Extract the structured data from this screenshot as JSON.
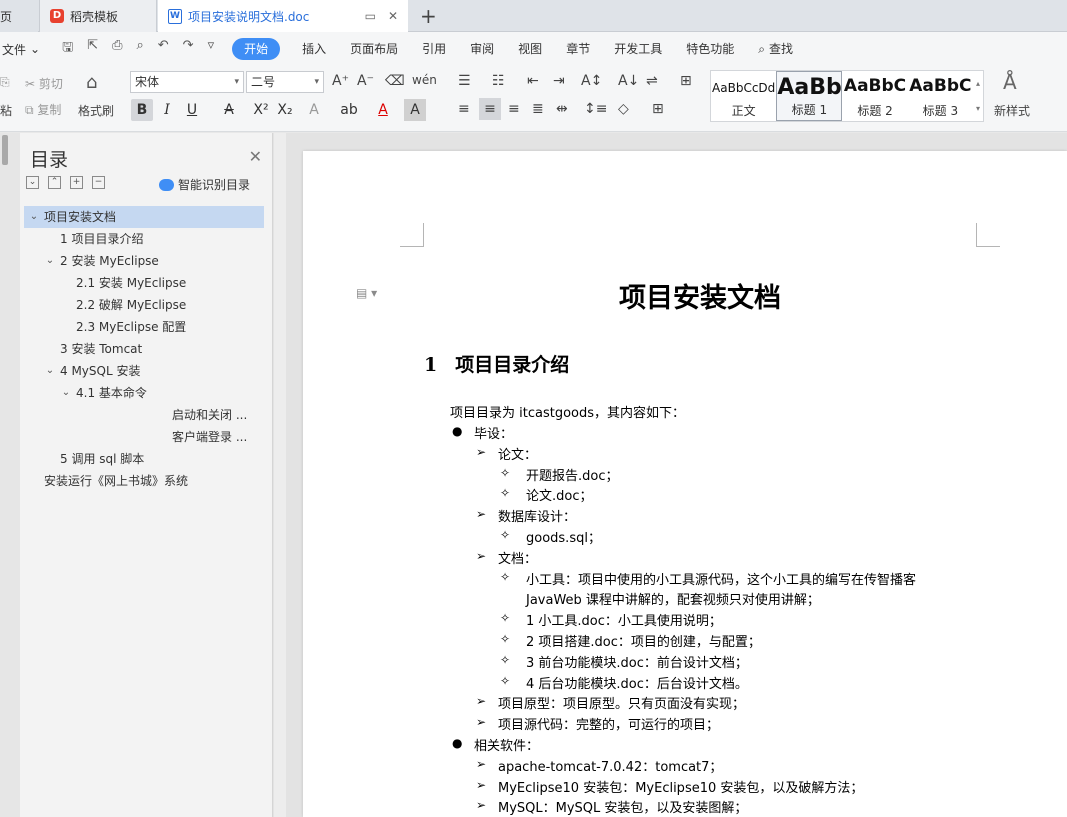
{
  "tabs": {
    "t1": "页",
    "t2": "稻壳模板",
    "t3": "项目安装说明文档.doc",
    "d_icon": "D",
    "w_icon": "W",
    "new_tab": "+"
  },
  "menu": {
    "file": "文件",
    "items": [
      "开始",
      "插入",
      "页面布局",
      "引用",
      "审阅",
      "视图",
      "章节",
      "开发工具",
      "特色功能"
    ],
    "search": "查找"
  },
  "toolbar": {
    "cut": "剪切",
    "copy": "复制",
    "paste_short": "粘",
    "format_painter": "格式刷",
    "font_name": "宋体",
    "font_size": "二号",
    "new_style": "新样式",
    "styles": [
      {
        "sample": "AaBbCcDd",
        "label": "正文"
      },
      {
        "sample": "AaBb",
        "label": "标题 1"
      },
      {
        "sample": "AaBbC",
        "label": "标题 2"
      },
      {
        "sample": "AaBbC",
        "label": "标题 3"
      }
    ]
  },
  "toc": {
    "title": "目录",
    "smart": "智能识别目录",
    "items": [
      {
        "text": "项目安装文档",
        "level": 0,
        "expanded": true,
        "selected": true
      },
      {
        "text": "1   项目目录介绍",
        "level": 1
      },
      {
        "text": "2   安装 MyEclipse",
        "level": 1,
        "expanded": true
      },
      {
        "text": "2.1   安装 MyEclipse",
        "level": 2
      },
      {
        "text": "2.2   破解 MyEclipse",
        "level": 2
      },
      {
        "text": "2.3   MyEclipse 配置",
        "level": 2
      },
      {
        "text": "3   安装 Tomcat",
        "level": 1
      },
      {
        "text": "4   MySQL 安装",
        "level": 1,
        "expanded": true
      },
      {
        "text": "4.1   基本命令",
        "level": 2,
        "expanded": true
      },
      {
        "text": "启动和关闭 ...",
        "level": 3
      },
      {
        "text": "客户端登录 ...",
        "level": 3
      },
      {
        "text": "5   调用 sql 脚本",
        "level": 1
      },
      {
        "text": "安装运行《网上书城》系统",
        "level": 0
      }
    ]
  },
  "document": {
    "title": "项目安装文档",
    "h1_num": "1",
    "h1_text": "项目目录介绍",
    "intro": "项目目录为 itcastgoods，其内容如下：",
    "lines": [
      {
        "b": "●",
        "text": "毕设：",
        "lvl": 1
      },
      {
        "b": "➢",
        "text": "论文：",
        "lvl": 2
      },
      {
        "b": "✧",
        "text": "开题报告.doc；",
        "lvl": 3
      },
      {
        "b": "✧",
        "text": "论文.doc；",
        "lvl": 3
      },
      {
        "b": "➢",
        "text": "数据库设计：",
        "lvl": 2
      },
      {
        "b": "✧",
        "text": "goods.sql；",
        "lvl": 3
      },
      {
        "b": "➢",
        "text": "文档：",
        "lvl": 2
      },
      {
        "b": "✧",
        "text": "小工具：项目中使用的小工具源代码，这个小工具的编写在传智播客",
        "lvl": 3
      },
      {
        "b": "",
        "text": "JavaWeb 课程中讲解的，配套视频只对使用讲解；",
        "lvl": 3
      },
      {
        "b": "✧",
        "text": "1 小工具.doc：小工具使用说明；",
        "lvl": 3
      },
      {
        "b": "✧",
        "text": "2 项目搭建.doc：项目的创建，与配置；",
        "lvl": 3
      },
      {
        "b": "✧",
        "text": "3 前台功能模块.doc：前台设计文档；",
        "lvl": 3
      },
      {
        "b": "✧",
        "text": "4 后台功能模块.doc：后台设计文档。",
        "lvl": 3
      },
      {
        "b": "➢",
        "text": "项目原型：项目原型。只有页面没有实现；",
        "lvl": 2
      },
      {
        "b": "➢",
        "text": "项目源代码：完整的，可运行的项目；",
        "lvl": 2
      },
      {
        "b": "●",
        "text": "相关软件：",
        "lvl": 1
      },
      {
        "b": "➢",
        "text": "apache-tomcat-7.0.42：tomcat7；",
        "lvl": 2
      },
      {
        "b": "➢",
        "text": "MyEclipse10 安装包：MyEclipse10 安装包，以及破解方法；",
        "lvl": 2
      },
      {
        "b": "➢",
        "text": "MySQL：MySQL 安装包，以及安装图解；",
        "lvl": 2
      }
    ]
  }
}
